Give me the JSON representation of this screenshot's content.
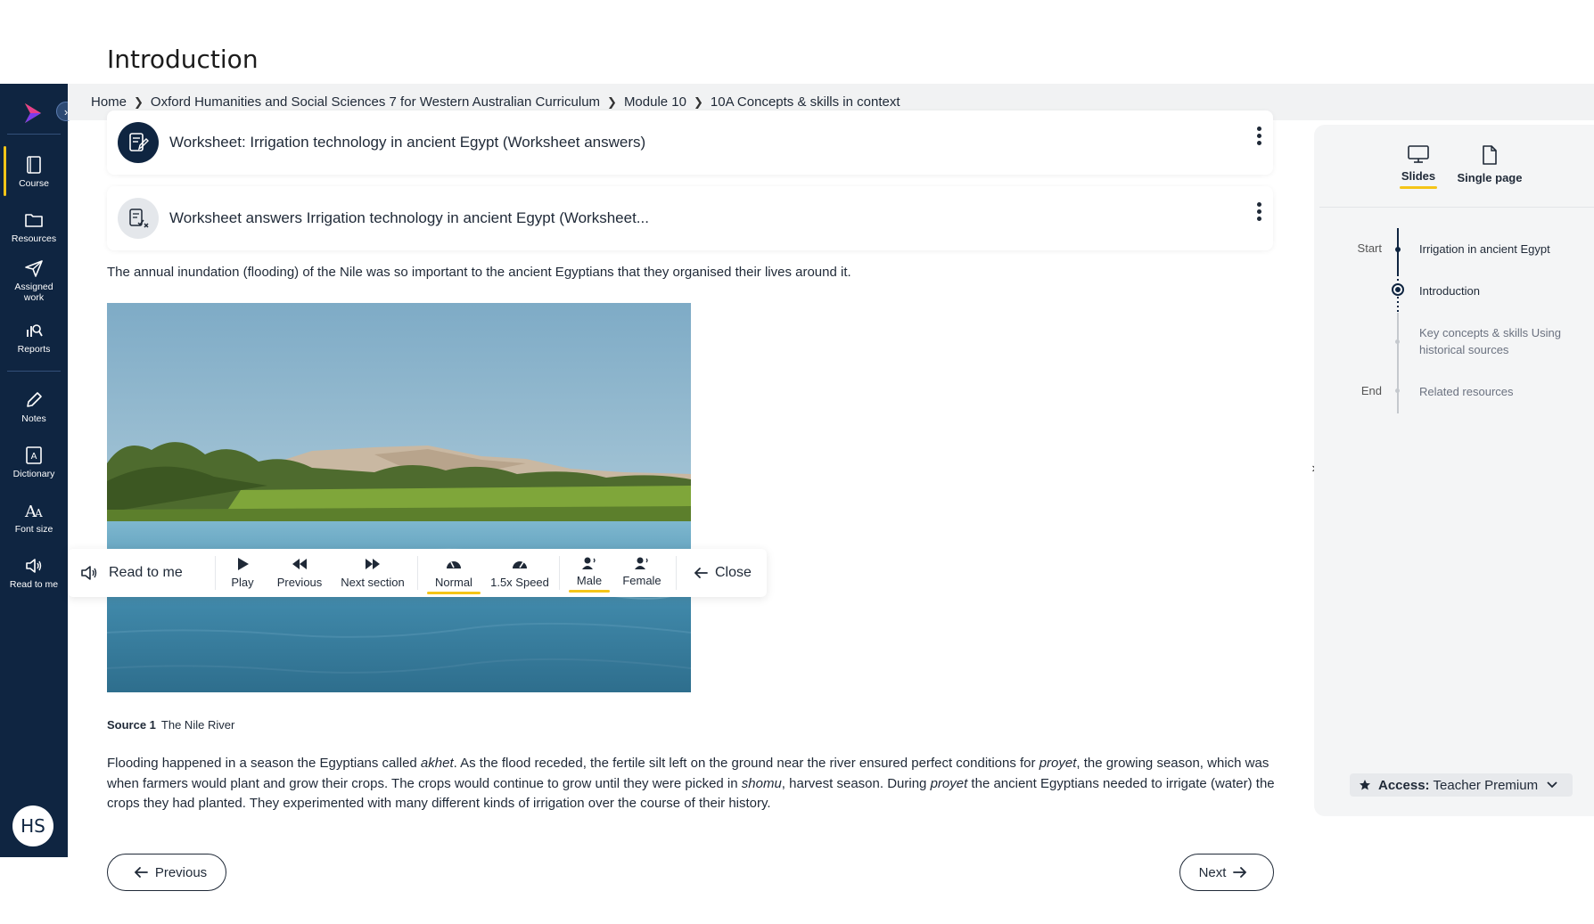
{
  "page": {
    "title": "Introduction"
  },
  "sidebar": {
    "items": [
      {
        "label": "Course",
        "icon": "book-icon"
      },
      {
        "label": "Resources",
        "icon": "folder-icon"
      },
      {
        "label": "Assigned work",
        "icon": "send-icon"
      },
      {
        "label": "Reports",
        "icon": "reports-icon"
      },
      {
        "label": "Notes",
        "icon": "pencil-icon"
      },
      {
        "label": "Dictionary",
        "icon": "dictionary-icon"
      },
      {
        "label": "Font size",
        "icon": "font-size-icon"
      },
      {
        "label": "Read to me",
        "icon": "speaker-icon"
      }
    ],
    "avatar_initials": "HS",
    "accent_color": "#f5c518",
    "bg_color": "#0f2541"
  },
  "breadcrumb": [
    "Home",
    "Oxford Humanities and Social Sciences 7 for Western Australian Curriculum",
    "Module 10",
    "10A Concepts & skills in context"
  ],
  "worksheets": [
    {
      "title": "Worksheet: Irrigation technology in ancient Egypt (Worksheet answers)",
      "icon": "worksheet-edit-icon"
    },
    {
      "title": "Worksheet answers Irrigation technology in ancient Egypt (Worksheet...",
      "icon": "worksheet-answers-icon"
    }
  ],
  "content": {
    "intro": "The annual inundation (flooding) of the Nile was so important to the ancient Egyptians that they organised their lives around it.",
    "caption_label": "Source 1",
    "caption_text": "The Nile River",
    "body": {
      "p1": "Flooding happened in a season the Egyptians called ",
      "t1": "akhet",
      "p2": ". As the flood receded, the fertile silt left on the ground near the river ensured perfect conditions for ",
      "t2": "proyet",
      "p3": ", the growing season, which was when farmers would plant and grow their crops. The crops would continue to grow until they were picked in ",
      "t3": "shomu",
      "p4": ", harvest season. During ",
      "t4": "proyet",
      "p5": " the ancient Egyptians needed to irrigate (water) the crops they had planted. They experimented with many different kinds of irrigation over the course of their history."
    }
  },
  "read_to_me": {
    "label": "Read to me",
    "play": "Play",
    "previous": "Previous",
    "next_section": "Next section",
    "normal": "Normal",
    "speed": "1.5x Speed",
    "male": "Male",
    "female": "Female",
    "close": "Close"
  },
  "nav": {
    "previous": "Previous",
    "next": "Next"
  },
  "right_panel": {
    "tabs": [
      {
        "label": "Slides",
        "icon": "monitor-icon",
        "selected": true
      },
      {
        "label": "Single page",
        "icon": "page-icon",
        "selected": false
      }
    ],
    "timeline": {
      "start_label": "Start",
      "end_label": "End",
      "items": [
        "Irrigation in ancient Egypt",
        "Introduction",
        "Key concepts & skills Using historical sources",
        "Related resources"
      ],
      "current_index": 1
    },
    "access_label": "Access:",
    "access_value": "Teacher Premium"
  }
}
